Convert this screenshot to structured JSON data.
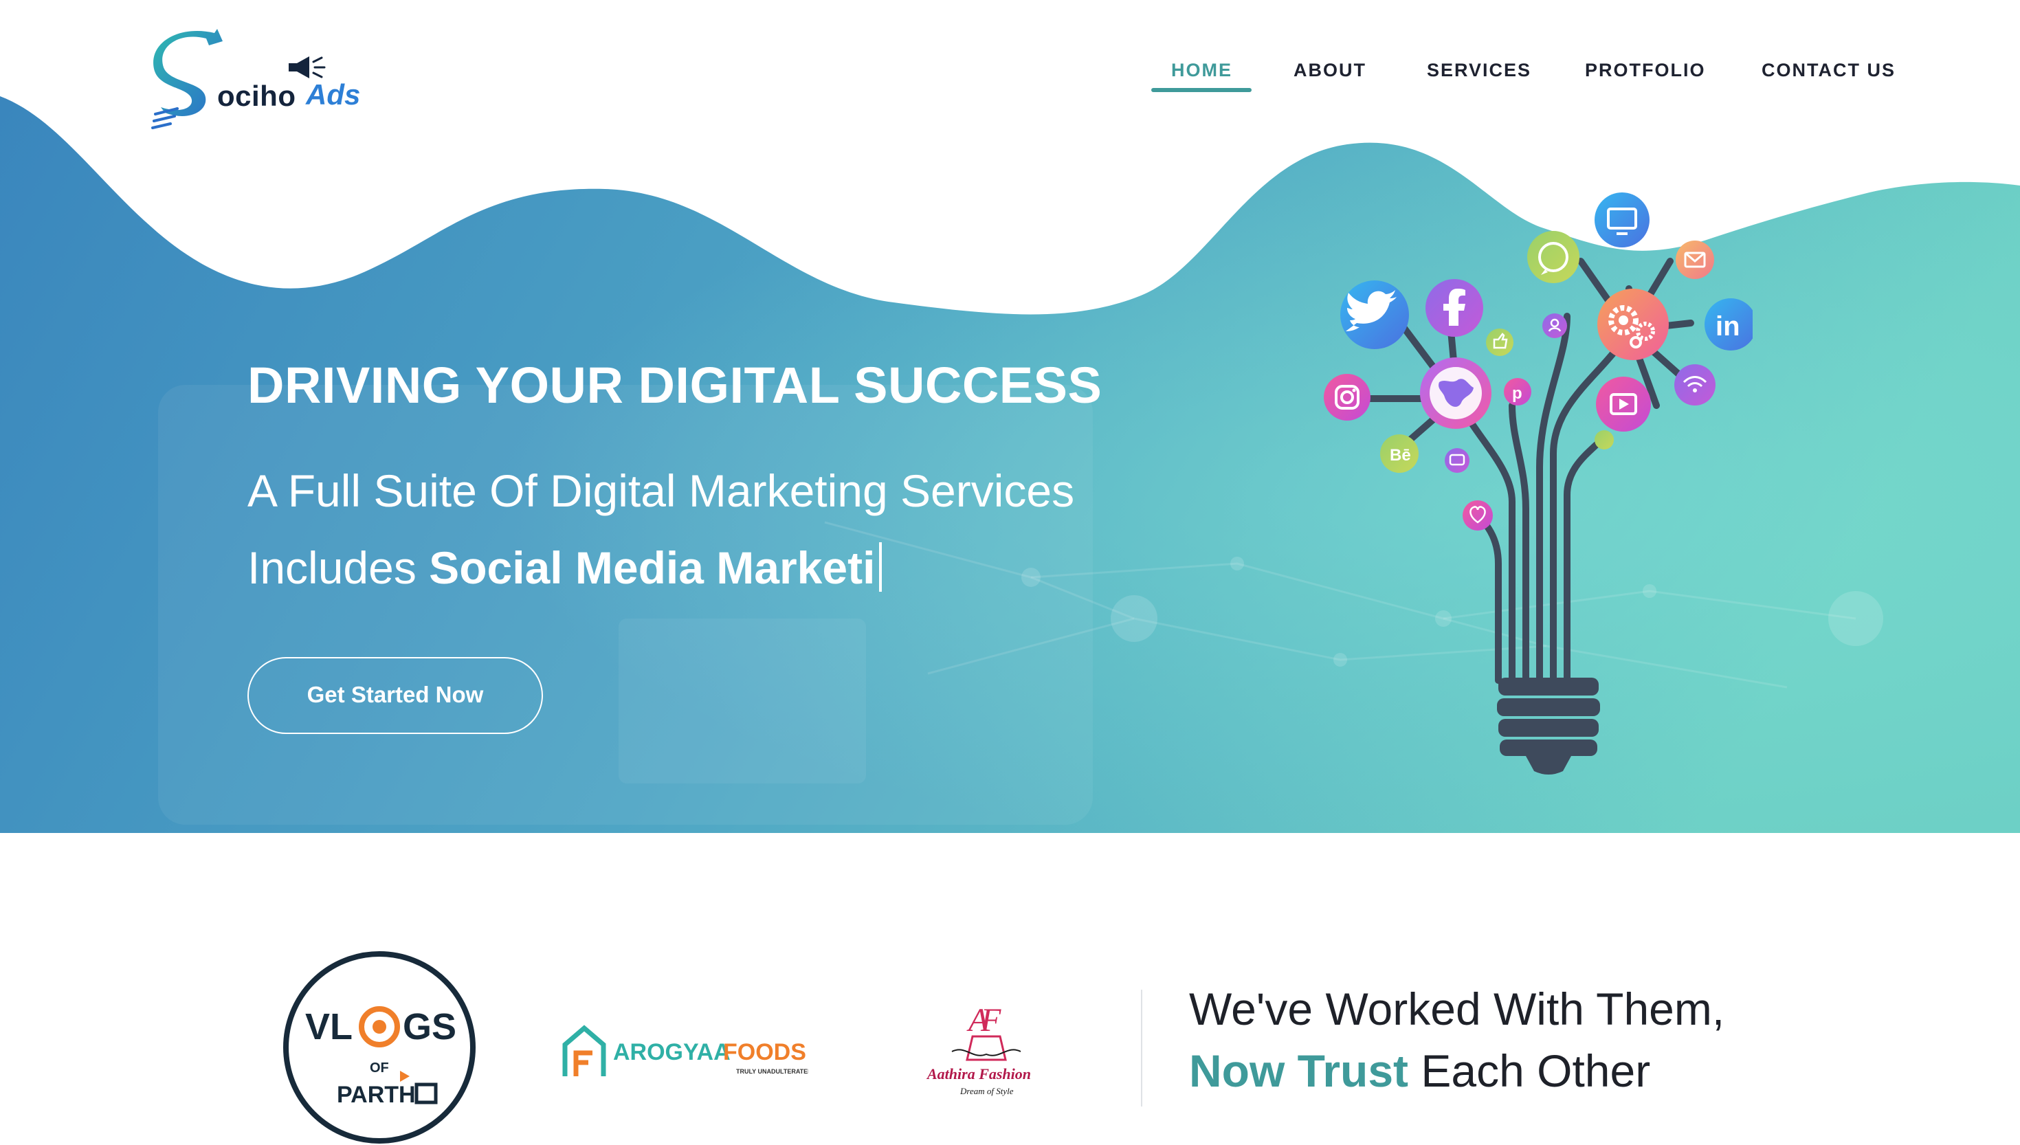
{
  "brand": {
    "logo_text_1": "ociho",
    "logo_text_2": "Ads"
  },
  "nav": {
    "items": [
      {
        "label": "HOME",
        "active": true
      },
      {
        "label": "ABOUT",
        "active": false
      },
      {
        "label": "SERVICES",
        "active": false
      },
      {
        "label": "PROTFOLIO",
        "active": false
      },
      {
        "label": "CONTACT US",
        "active": false
      }
    ]
  },
  "hero": {
    "title": "DRIVING YOUR DIGITAL SUCCESS",
    "subtitle": "A Full Suite Of Digital Marketing Services",
    "line2_prefix": "Includes ",
    "line2_typed": "Social Media Marketi",
    "cta_label": "Get Started Now"
  },
  "clients": {
    "vlogs": {
      "line1": "VL",
      "line2": "GS",
      "of": "OF",
      "name": "PARTH"
    },
    "arogyaa": {
      "name_1": "AROGYAA",
      "name_2": "FOODS",
      "tagline": "TRULY UNADULTERATED"
    },
    "aathira": {
      "name": "Aathira Fashion",
      "tagline": "Dream of Style"
    }
  },
  "trust": {
    "line1": "We've Worked With Them,",
    "accent": "Now Trust",
    "rest": " Each Other"
  },
  "colors": {
    "primary_teal": "#3f9a9a",
    "hero_blue": "#3c8cc0",
    "hero_teal": "#6fd2c8",
    "text_dark": "#1e2129"
  },
  "icons": [
    "twitter-icon",
    "facebook-icon",
    "instagram-icon",
    "globe-icon",
    "behance-icon",
    "pinterest-icon",
    "whatsapp-icon",
    "monitor-icon",
    "mail-icon",
    "gears-icon",
    "linkedin-icon",
    "youtube-icon",
    "wifi-icon",
    "heart-icon",
    "chat-icon",
    "user-icon",
    "like-icon"
  ]
}
